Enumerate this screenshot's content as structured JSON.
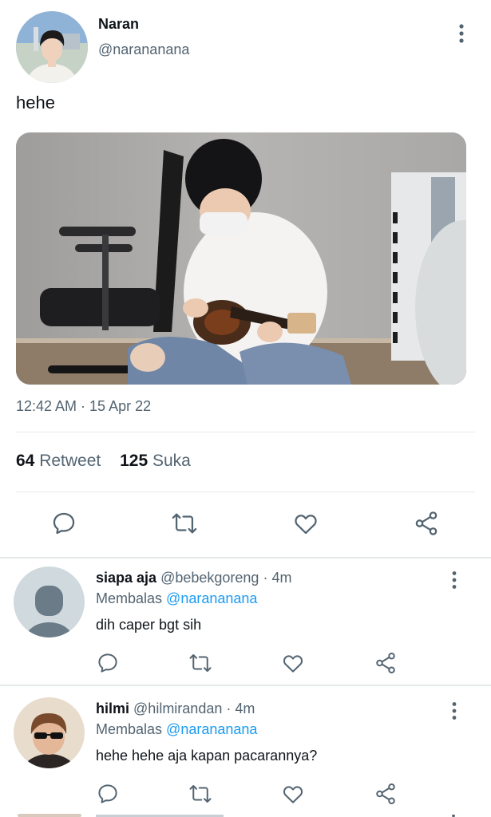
{
  "tweet": {
    "author_name": "Naran",
    "author_handle": "@narananana",
    "text": "hehe",
    "timestamp": "12:42 AM · 15 Apr 22",
    "stats": {
      "retweet_count": "64",
      "retweet_label": "Retweet",
      "like_count": "125",
      "like_label": "Suka"
    },
    "actions": [
      "reply-icon",
      "retweet-icon",
      "like-icon",
      "share-icon"
    ]
  },
  "replies": [
    {
      "name": "siapa aja",
      "handle": "@bebekgoreng",
      "time": "· 4m",
      "reply_prefix": "Membalas",
      "reply_to": "@narananana",
      "text": "dih caper bgt sih"
    },
    {
      "name": "hilmi",
      "handle": "@hilmirandan",
      "time": "· 4m",
      "reply_prefix": "Membalas",
      "reply_to": "@narananana",
      "text": "hehe hehe aja kapan pacarannya?"
    }
  ],
  "colors": {
    "accent": "#1d9bf0",
    "secondary_text": "#536471",
    "primary_text": "#0f1419",
    "icon": "#536471"
  }
}
